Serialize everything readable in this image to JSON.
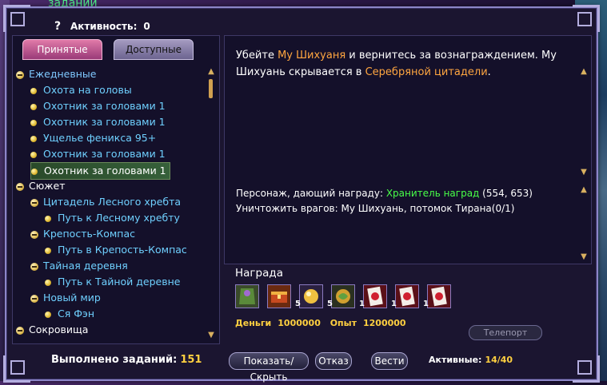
{
  "window_title_partial": "заданий",
  "header": {
    "help_icon": "?",
    "activity_label": "Активность:",
    "activity_value": "0"
  },
  "tabs": [
    {
      "label": "Принятые",
      "active": true
    },
    {
      "label": "Доступные",
      "active": false
    }
  ],
  "tree": [
    {
      "type": "category",
      "label": "Ежедневные"
    },
    {
      "type": "item",
      "label": "Охота на головы"
    },
    {
      "type": "item",
      "label": "Охотник за головами 1"
    },
    {
      "type": "item",
      "label": "Охотник за головами 1"
    },
    {
      "type": "item",
      "label": "Ущелье феникса 95+"
    },
    {
      "type": "item",
      "label": "Охотник за головами 1"
    },
    {
      "type": "item",
      "label": "Охотник за головами 1",
      "selected": true
    },
    {
      "type": "category",
      "label": "Сюжет"
    },
    {
      "type": "subcategory",
      "label": "Цитадель Лесного хребта"
    },
    {
      "type": "subitem",
      "label": "Путь к Лесному хребту"
    },
    {
      "type": "subcategory",
      "label": "Крепость-Компас"
    },
    {
      "type": "subitem",
      "label": "Путь в Крепость-Компас"
    },
    {
      "type": "subcategory",
      "label": "Тайная деревня"
    },
    {
      "type": "subitem",
      "label": "Путь к Тайной деревне"
    },
    {
      "type": "subcategory",
      "label": "Новый мир"
    },
    {
      "type": "subitem",
      "label": "Ся Фэн"
    },
    {
      "type": "category",
      "label": "Сокровища"
    }
  ],
  "description": {
    "p1": "Убейте ",
    "target1": "Му Шихуаня",
    "p2": " и вернитесь за вознаграждением. Му Шихуань скрывается в ",
    "target2": "Серебряной цитадели",
    "p3": "."
  },
  "info": {
    "npc_label": "Персонаж, дающий награду: ",
    "npc_name": "Хранитель наград",
    "npc_coords": " (554, 653)",
    "objective": "Уничтожить врагов: Му Шихуань, потомок Тирана(0/1)"
  },
  "reward": {
    "title": "Награда",
    "icons": [
      {
        "name": "cloak-item-icon",
        "qty": ""
      },
      {
        "name": "chest-item-icon",
        "qty": ""
      },
      {
        "name": "gold-orb-icon",
        "qty": "5"
      },
      {
        "name": "green-orb-icon",
        "qty": "5"
      },
      {
        "name": "card-red-icon",
        "qty": "1"
      },
      {
        "name": "card-red-icon",
        "qty": "1"
      },
      {
        "name": "card-red-icon",
        "qty": "1"
      }
    ],
    "money_label": "Деньги",
    "money_value": "1000000",
    "exp_label": "Опыт",
    "exp_value": "1200000",
    "teleport_label": "Телепорт"
  },
  "footer": {
    "completed_label": "Выполнено заданий:",
    "completed_value": "151",
    "show_hide_label": "Показать/Скрыть",
    "refuse_label": "Отказ",
    "lead_label": "Вести",
    "active_label": "Активные:",
    "active_value": "14/40"
  },
  "colors": {
    "highlight": "#ffa640",
    "npc": "#48ff48",
    "link": "#6fd0ff",
    "gold": "#ffd040"
  }
}
